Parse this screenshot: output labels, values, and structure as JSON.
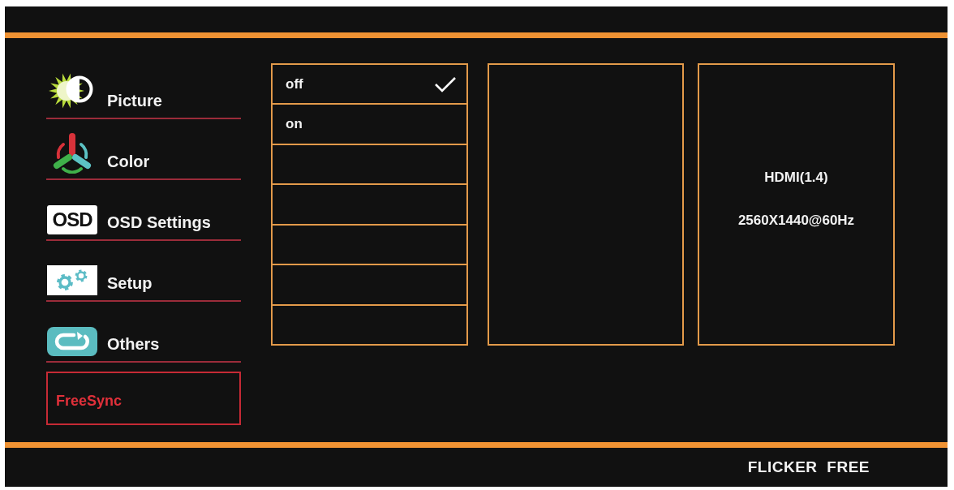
{
  "sidebar": {
    "items": [
      {
        "label": "Picture",
        "selected": false
      },
      {
        "label": "Color",
        "selected": false
      },
      {
        "label": "OSD Settings",
        "badge": "OSD",
        "selected": false
      },
      {
        "label": "Setup",
        "selected": false
      },
      {
        "label": "Others",
        "selected": false
      },
      {
        "label": "FreeSync",
        "selected": true
      }
    ]
  },
  "options": [
    {
      "label": "off",
      "selected": true
    },
    {
      "label": "on",
      "selected": false
    }
  ],
  "info_panel": {
    "lines": [
      "HDMI(1.4)",
      "2560X1440@60Hz"
    ]
  },
  "footer": {
    "text": "FLICKER FREE"
  }
}
